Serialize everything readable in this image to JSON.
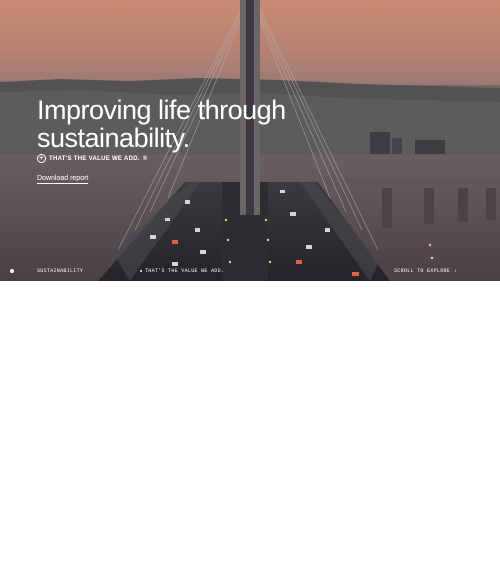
{
  "hero": {
    "title_line1": "Improving life through",
    "title_line2": "sustainability.",
    "tagline": "THAT'S THE VALUE WE ADD.",
    "tagline_mark": "®",
    "download_label": "Download report"
  },
  "footer": {
    "section_label": "SUSTAINABILITY",
    "center_text": "THAT'S THE VALUE WE ADD.",
    "scroll_label": "SCROLL TO EXPLORE"
  }
}
